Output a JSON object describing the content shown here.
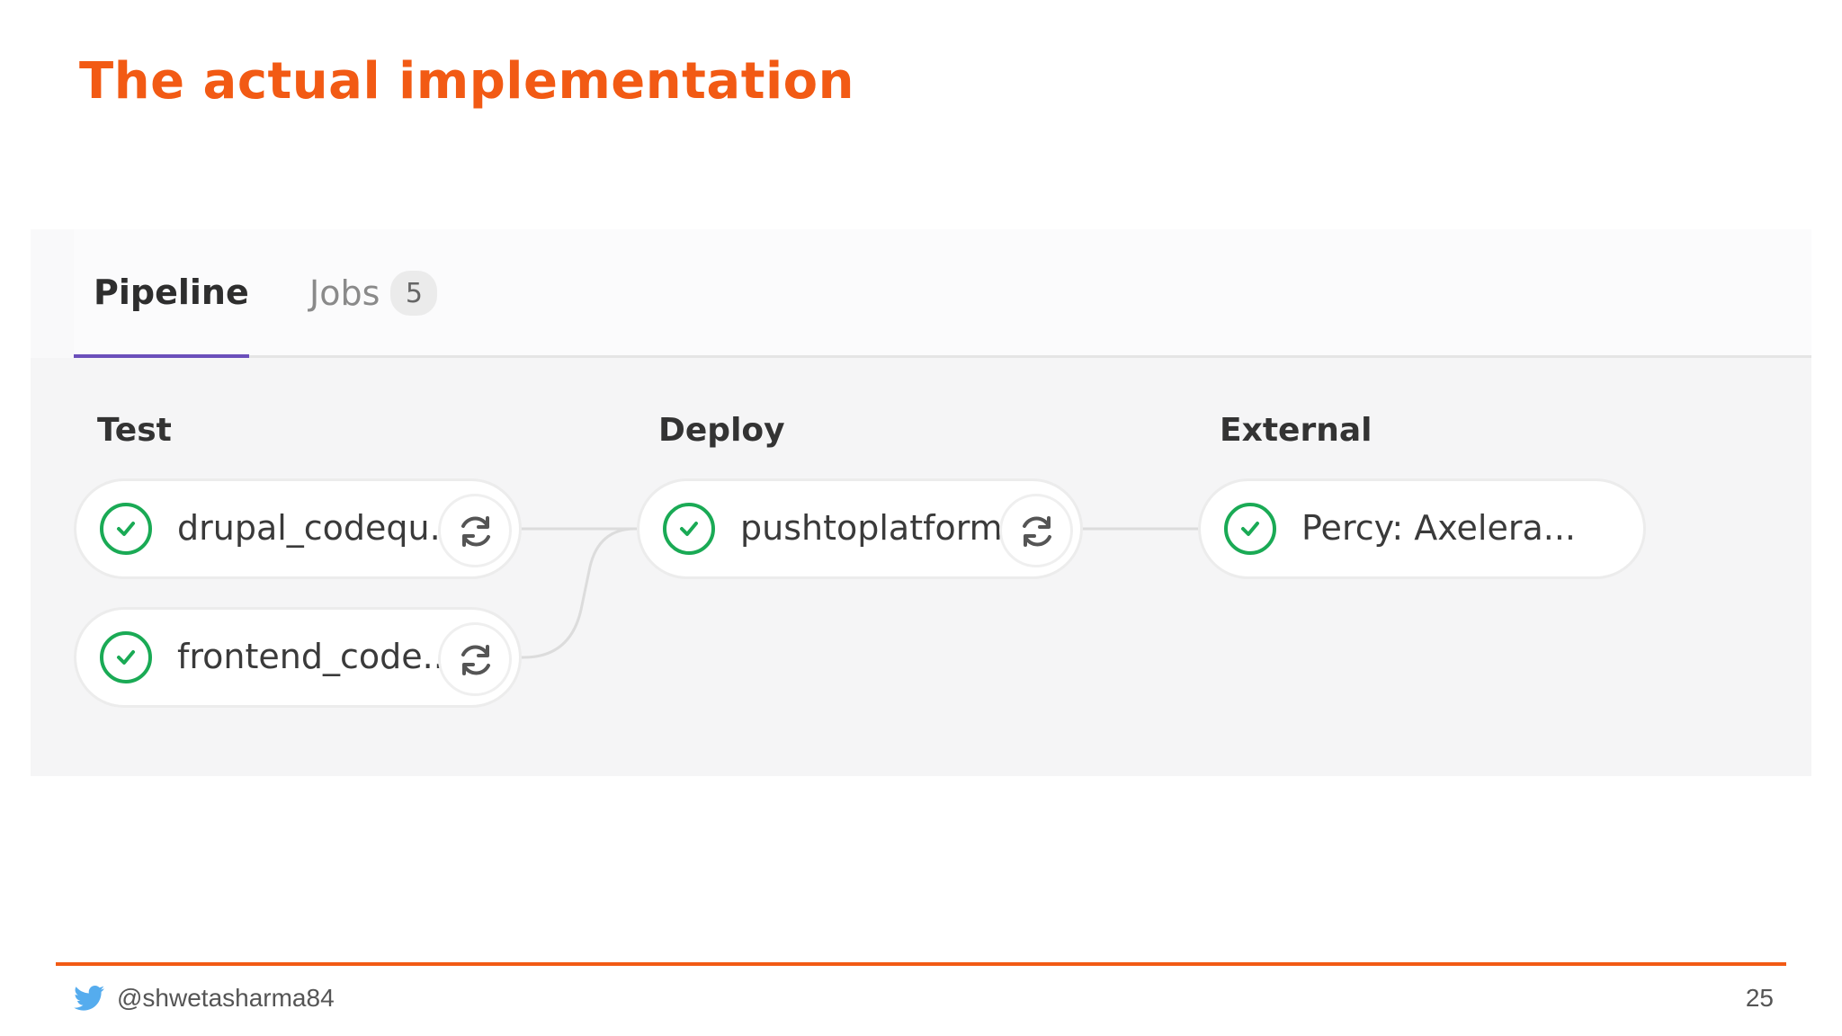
{
  "slide": {
    "title": "The actual implementation",
    "footer_handle": "@shwetasharma84",
    "page_number": "25",
    "accent_color": "#f25a14",
    "footer_icon": "twitter-bird-icon"
  },
  "tabs": {
    "pipeline_label": "Pipeline",
    "jobs_label": "Jobs",
    "jobs_count": "5",
    "active_tab": "Pipeline",
    "active_color": "#6b4fbb"
  },
  "stages": [
    {
      "title": "Test",
      "jobs": [
        {
          "name": "drupal_codequ...",
          "status": "passed",
          "action": "retry-icon"
        },
        {
          "name": "frontend_code...",
          "status": "passed",
          "action": "retry-icon"
        }
      ]
    },
    {
      "title": "Deploy",
      "jobs": [
        {
          "name": "pushtoplatform",
          "status": "passed",
          "action": "retry-icon"
        }
      ]
    },
    {
      "title": "External",
      "jobs": [
        {
          "name": "Percy: Axelera...",
          "status": "passed"
        }
      ]
    }
  ],
  "status_color": "#1aaa55"
}
